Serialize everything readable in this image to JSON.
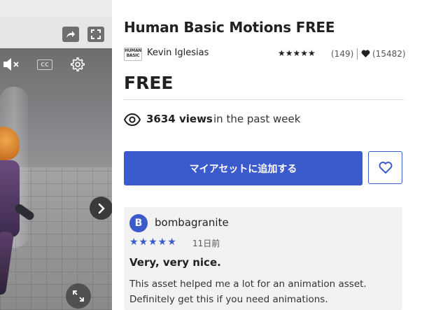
{
  "asset": {
    "title": "Human Basic Motions FREE",
    "publisher": {
      "name": "Kevin Iglesias",
      "logo_text": "HUMAN BASIC"
    },
    "rating": {
      "stars": "★★★★★",
      "review_count": "(149)",
      "favorites": "(15482)"
    },
    "price": "FREE",
    "views": {
      "count": "3634 views",
      "suffix": "in the past week"
    }
  },
  "media": {
    "share_icon": "share-arrow",
    "fullscreen_icon": "fullscreen",
    "mute_icon": "speaker-muted",
    "cc_label": "CC",
    "settings_icon": "gear",
    "next_icon": "chevron-right",
    "expand_icon": "expand-arrows"
  },
  "actions": {
    "add_to_assets": "マイアセットに追加する",
    "favorite_icon": "heart-outline"
  },
  "review": {
    "avatar_letter": "B",
    "author": "bombagranite",
    "stars": "★★★★★",
    "date": "11日前",
    "title": "Very, very nice.",
    "body_lines": [
      "This asset helped me a lot for an animation asset.",
      "Definitely get this if you need animations."
    ]
  },
  "colors": {
    "accent": "#3b5bcc",
    "text": "#212121",
    "card_bg": "#f2f2f2"
  }
}
